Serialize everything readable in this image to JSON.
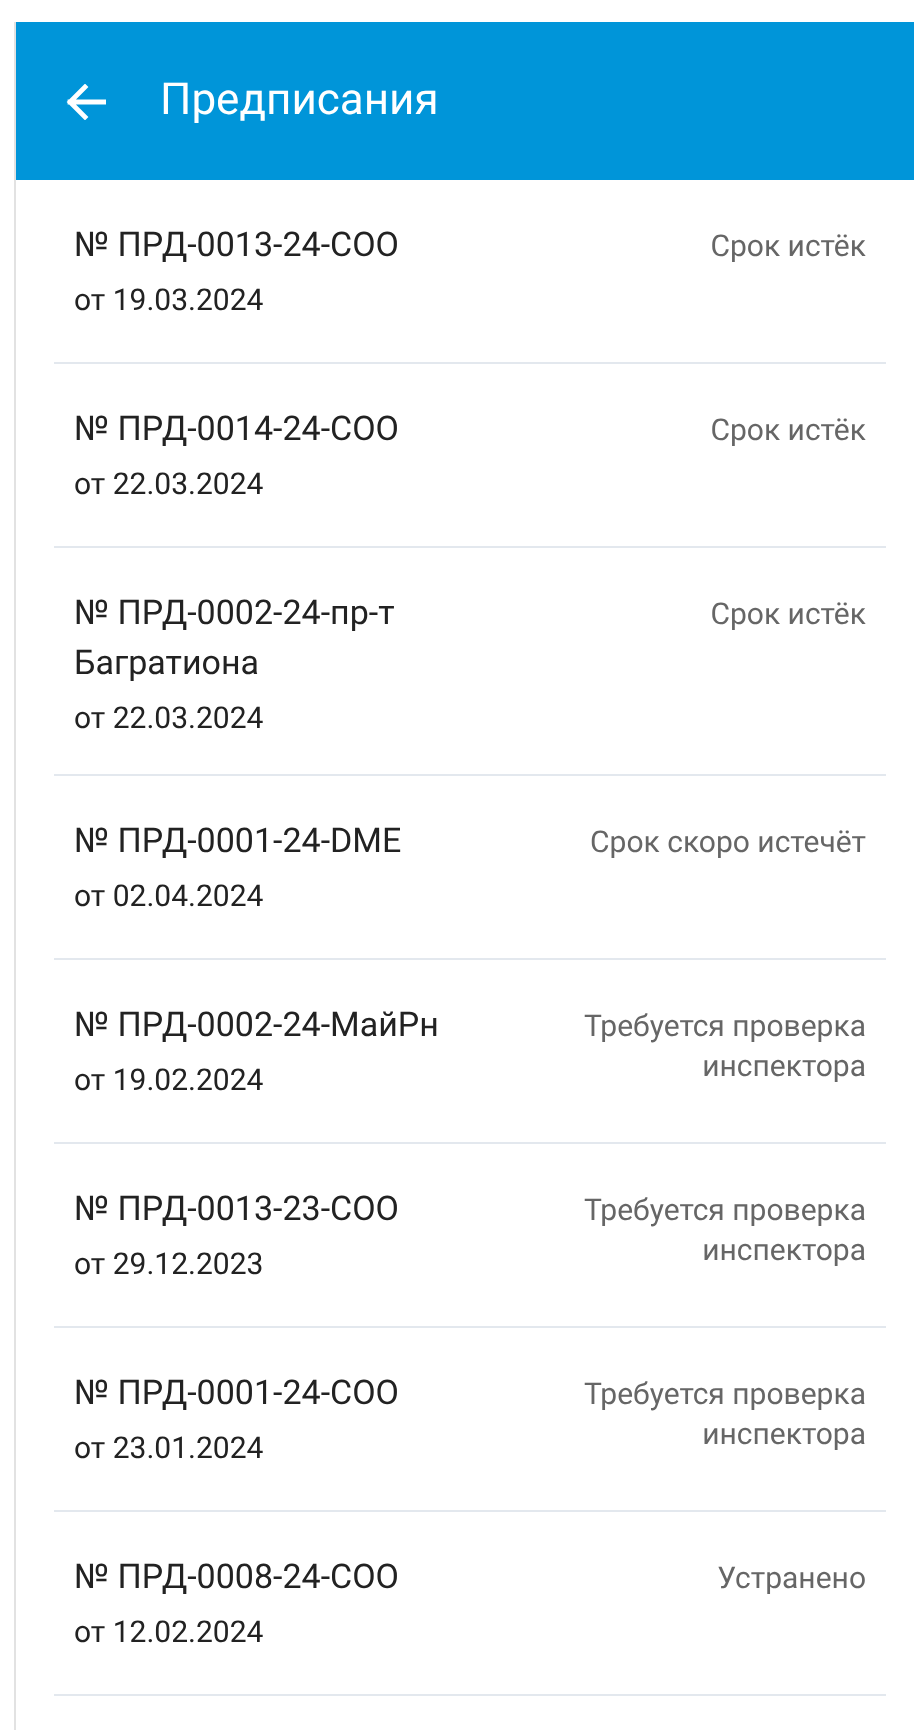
{
  "app_bar": {
    "title": "Предписания"
  },
  "items": [
    {
      "title": "№ ПРД-0013-24-СОО",
      "date": "от 19.03.2024",
      "status": "Срок истёк"
    },
    {
      "title": "№ ПРД-0014-24-СОО",
      "date": "от 22.03.2024",
      "status": "Срок истёк"
    },
    {
      "title": "№ ПРД-0002-24-пр-т Багратиона",
      "date": "от 22.03.2024",
      "status": "Срок истёк"
    },
    {
      "title": "№ ПРД-0001-24-DME",
      "date": "от 02.04.2024",
      "status": "Срок скоро истечёт"
    },
    {
      "title": "№ ПРД-0002-24-МайРн",
      "date": "от 19.02.2024",
      "status": "Требуется проверка инспектора"
    },
    {
      "title": "№ ПРД-0013-23-СОО",
      "date": "от 29.12.2023",
      "status": "Требуется проверка инспектора"
    },
    {
      "title": "№ ПРД-0001-24-СОО",
      "date": "от 23.01.2024",
      "status": "Требуется проверка инспектора"
    },
    {
      "title": "№ ПРД-0008-24-СОО",
      "date": "от 12.02.2024",
      "status": "Устранено"
    }
  ]
}
